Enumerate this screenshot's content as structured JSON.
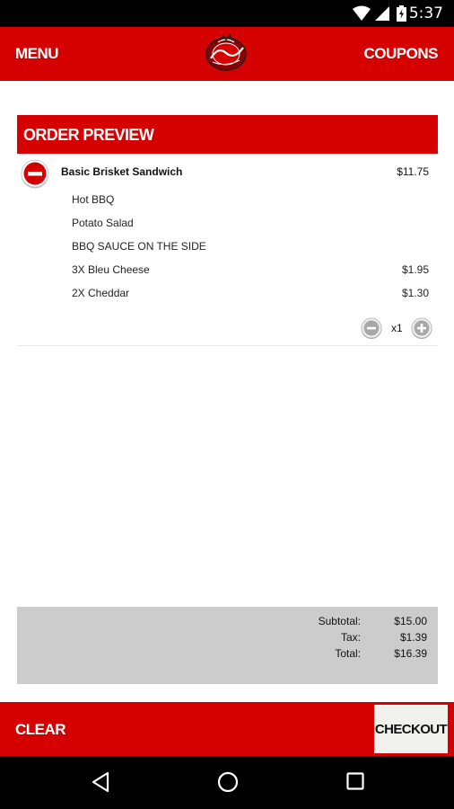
{
  "status_bar": {
    "time": "5:37",
    "icons": [
      "wifi-icon",
      "signal-icon",
      "battery-icon"
    ]
  },
  "app_bar": {
    "left_label": "MENU",
    "right_label": "COUPONS",
    "logo": "windy-city-logo"
  },
  "order_preview": {
    "header": "ORDER PREVIEW",
    "item": {
      "name": "Basic Brisket Sandwich",
      "price": "$11.75",
      "modifiers": [
        {
          "label": "Hot BBQ",
          "price": ""
        },
        {
          "label": "Potato Salad",
          "price": ""
        },
        {
          "label": "BBQ SAUCE ON THE SIDE",
          "price": ""
        },
        {
          "label": "3X Bleu Cheese",
          "price": "$1.95"
        },
        {
          "label": "2X Cheddar",
          "price": "$1.30"
        }
      ],
      "quantity": "x1"
    }
  },
  "totals": {
    "subtotal_label": "Subtotal:",
    "subtotal": "$15.00",
    "tax_label": "Tax:",
    "tax": "$1.39",
    "total_label": "Total:",
    "total": "$16.39"
  },
  "bottom_bar": {
    "clear_label": "CLEAR",
    "checkout_label": "CHECKOUT"
  },
  "colors": {
    "brand_red": "#d50000",
    "totals_bg": "#cccccc",
    "status_bar": "#000000"
  }
}
